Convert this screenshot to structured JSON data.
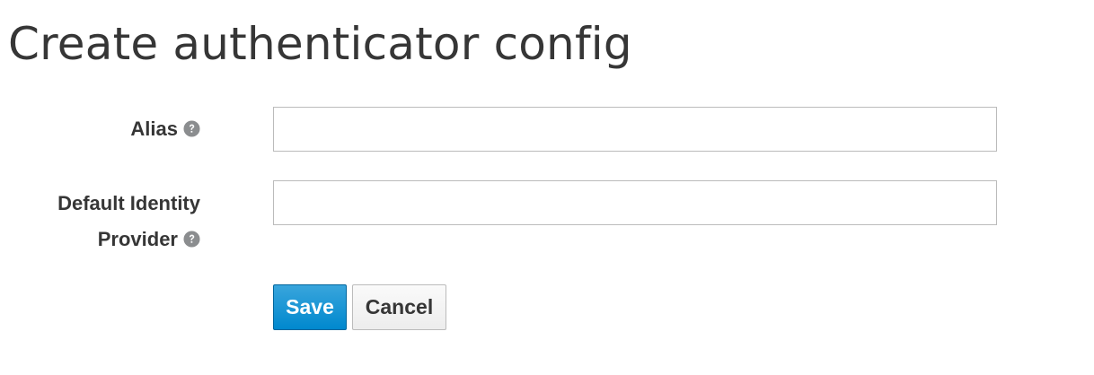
{
  "page": {
    "title": "Create authenticator config"
  },
  "form": {
    "alias": {
      "label": "Alias",
      "value": "",
      "help_icon": "question-circle-icon"
    },
    "default_identity_provider": {
      "label_line1": "Default Identity",
      "label_line2": "Provider",
      "value": "",
      "help_icon": "question-circle-icon"
    }
  },
  "buttons": {
    "save_label": "Save",
    "cancel_label": "Cancel"
  },
  "colors": {
    "primary": "#0088ce",
    "text": "#363636",
    "help_icon": "#8b8d8f"
  }
}
